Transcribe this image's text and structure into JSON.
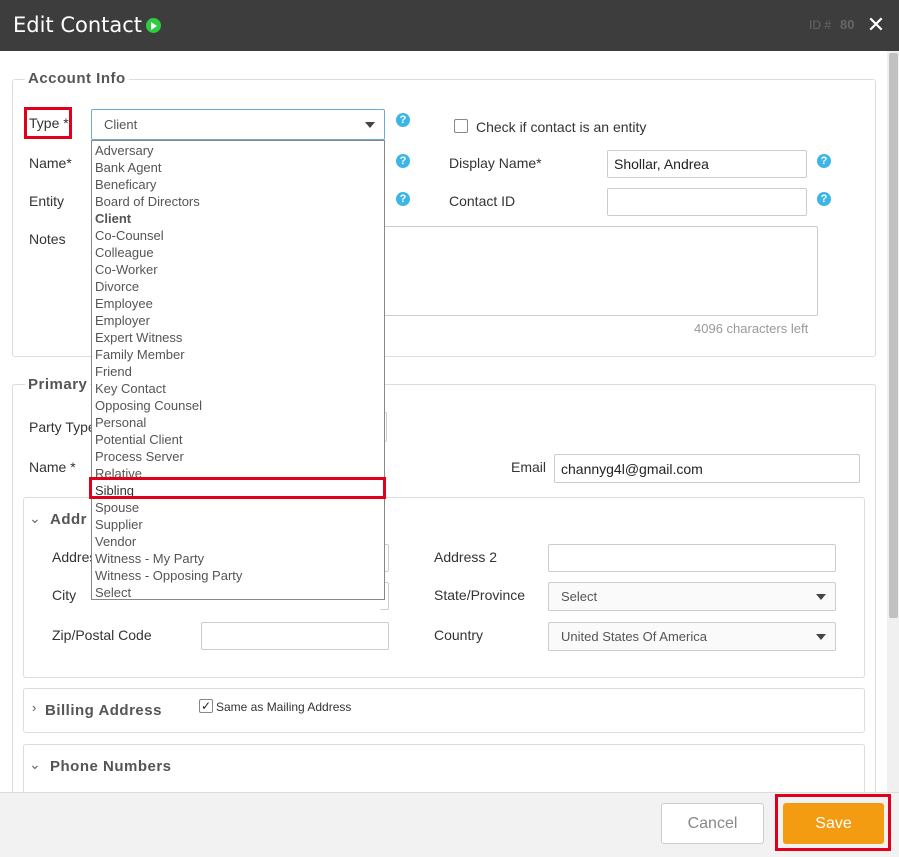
{
  "header": {
    "title": "Edit Contact",
    "id_label": "ID #",
    "id_value": "80",
    "close_glyph": "✕"
  },
  "account_info": {
    "legend": "Account Info",
    "type_label": "Type *",
    "type_value": "Client",
    "entity_checkbox_label": "Check if contact is an entity",
    "name_label": "Name*",
    "display_name_label": "Display Name*",
    "display_name_value": "Shollar, Andrea",
    "entity_label": "Entity",
    "contact_id_label": "Contact ID",
    "contact_id_value": "",
    "notes_label": "Notes",
    "notes_counter": "4096 characters left"
  },
  "type_dropdown": {
    "options": [
      "Adversary",
      "Bank Agent",
      "Beneficary",
      "Board of Directors",
      "Client",
      "Co-Counsel",
      "Colleague",
      "Co-Worker",
      "Divorce",
      "Employee",
      "Employer",
      "Expert Witness",
      "Family Member",
      "Friend",
      "Key Contact",
      "Opposing Counsel",
      "Personal",
      "Potential Client",
      "Process Server",
      "Relative",
      "Sibling",
      "Spouse",
      "Supplier",
      "Vendor",
      "Witness - My Party",
      "Witness - Opposing Party",
      "Select"
    ],
    "current": "Client",
    "highlighted": "Sibling"
  },
  "primary": {
    "legend": "Primary",
    "party_type_label": "Party Type",
    "name_label": "Name *",
    "email_label": "Email",
    "email_value": "channyg4l@gmail.com"
  },
  "address": {
    "title": "Addr",
    "address_label": "Addres",
    "address2_label": "Address 2",
    "city_label": "City",
    "state_label": "State/Province",
    "state_value": "Select",
    "zip_label": "Zip/Postal Code",
    "country_label": "Country",
    "country_value": "United States Of America"
  },
  "billing": {
    "title": "Billing Address",
    "same_as_label": "Same as Mailing Address",
    "same_as_checked": true
  },
  "phones": {
    "title": "Phone Numbers"
  },
  "footer": {
    "cancel_label": "Cancel",
    "save_label": "Save"
  },
  "colors": {
    "save": "#f39c12",
    "titlebar": "#3d3d3d",
    "highlight": "#e0001b",
    "help": "#3db5e5"
  }
}
